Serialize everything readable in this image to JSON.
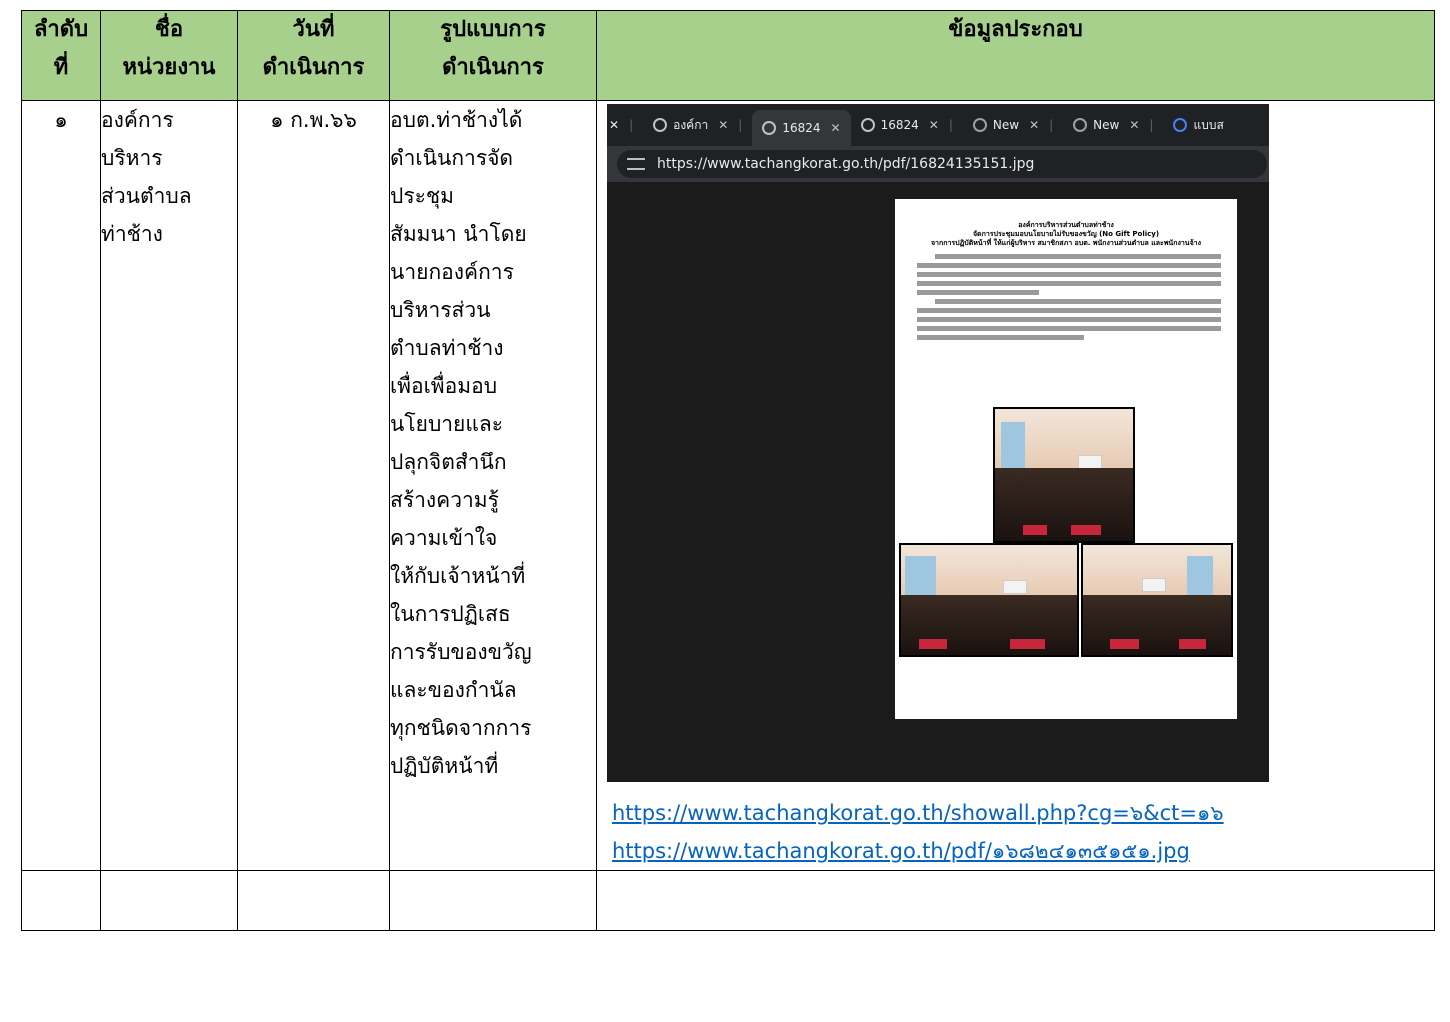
{
  "headers": {
    "col1": [
      "ลำดับ",
      "ที่"
    ],
    "col2": [
      "ชื่อ",
      "หน่วยงาน"
    ],
    "col3": [
      "วันที่",
      "ดำเนินการ"
    ],
    "col4": [
      "รูปแบบการ",
      "ดำเนินการ"
    ],
    "col5": [
      "ข้อมูลประกอบ"
    ]
  },
  "row": {
    "number": "๑",
    "agency_lines": [
      "องค์การ",
      "บริหาร",
      "ส่วนตำบล",
      "ท่าช้าง"
    ],
    "date": "๑ ก.พ.๖๖",
    "description_lines": [
      "อบต.ท่าช้างได้",
      "ดำเนินการจัด",
      "ประชุม",
      "สัมมนา นำโดย",
      "นายกองค์การ",
      "บริหารส่วน",
      "ตำบลท่าช้าง",
      "เพื่อเพื่อมอบ",
      "นโยบายและ",
      "ปลุกจิตสำนึก",
      "สร้างความรู้",
      "ความเข้าใจ",
      "ให้กับเจ้าหน้าที่",
      "ในการปฏิเสธ",
      "การรับของขวัญ",
      "และของกำนัล",
      "ทุกชนิดจากการ",
      "ปฏิบัติหน้าที่"
    ],
    "browser": {
      "tabs": [
        {
          "label": "องค์กา",
          "icon": "globe-icon",
          "active": false
        },
        {
          "label": "16824",
          "icon": "globe-icon",
          "active": true
        },
        {
          "label": "16824",
          "icon": "globe-icon",
          "active": false
        },
        {
          "label": "New",
          "icon": "chrome-icon",
          "active": false
        },
        {
          "label": "New",
          "icon": "chrome-icon",
          "active": false
        },
        {
          "label": "แบบส",
          "icon": "google-icon",
          "active": false
        }
      ],
      "url": "https://www.tachangkorat.go.th/pdf/16824135151.jpg"
    },
    "document": {
      "title_lines": [
        "องค์การบริหารส่วนตำบลท่าช้าง",
        "จัดการประชุมมอบนโยบายไม่รับของขวัญ (No Gift Policy)",
        "จากการปฏิบัติหน้าที่ ให้แก่ผู้บริหาร สมาชิกสภา อบต. พนักงานส่วนตำบล และพนักงานจ้าง"
      ]
    },
    "links": [
      "https://www.tachangkorat.go.th/showall.php?cg=๖&ct=๑๖",
      "https://www.tachangkorat.go.th/pdf/๑๖๘๒๔๑๓๕๑๕๑.jpg"
    ]
  },
  "colors": {
    "header_bg": "#a8d08d",
    "link": "#0563c1",
    "browser_bg": "#202124"
  }
}
